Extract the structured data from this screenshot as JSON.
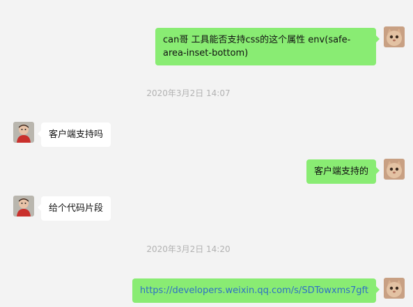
{
  "chat": {
    "top_timestamp_partial": "— —  · —",
    "messages": [
      {
        "side": "right",
        "text": "can哥 工具能否支持css的这个属性 env(safe-area-inset-bottom)"
      },
      {
        "timestamp": "2020年3月2日 14:07"
      },
      {
        "side": "left",
        "text": "客户端支持吗"
      },
      {
        "side": "right",
        "text": "客户端支持的"
      },
      {
        "side": "left",
        "text": "给个代码片段"
      },
      {
        "timestamp": "2020年3月2日 14:20"
      },
      {
        "side": "right",
        "text": "https://developers.weixin.qq.com/s/SDTowxms7gft",
        "is_link": true
      }
    ]
  },
  "colors": {
    "background": "#f3f3f3",
    "bubble_self": "#89ec73",
    "bubble_other": "#ffffff",
    "timestamp": "#b2b2b2",
    "link": "#2f6fc6"
  },
  "icons": {
    "self_avatar": "cat-avatar-icon",
    "other_avatar": "child-avatar-icon"
  }
}
